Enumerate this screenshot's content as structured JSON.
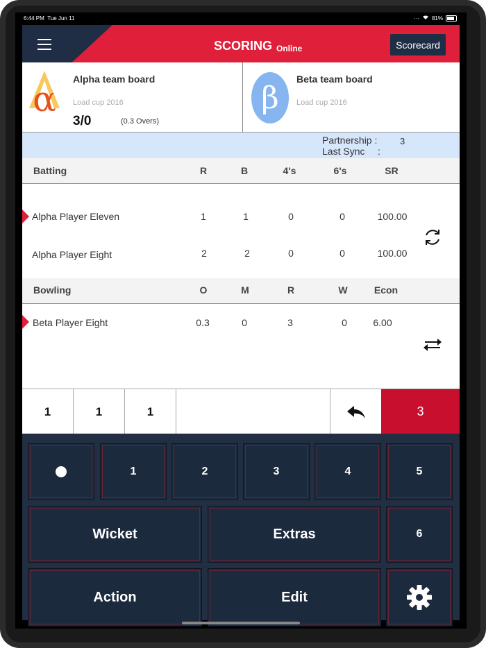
{
  "status_bar": {
    "time": "6:44 PM",
    "date": "Tue Jun 11",
    "battery": "81%"
  },
  "header": {
    "title": "SCORING",
    "status": "Online",
    "scorecard_label": "Scorecard"
  },
  "team_a": {
    "name": "Alpha team board",
    "tournament": "Load cup 2016",
    "score": "3/0",
    "overs": "(0.3 Overs)",
    "logo": "alpha-logo"
  },
  "team_b": {
    "name": "Beta team board",
    "tournament": "Load cup 2016",
    "logo": "beta-logo",
    "logo_glyph": "β"
  },
  "info": {
    "partnership_label": "Partnership :",
    "partnership_value": "3",
    "last_sync_label": "Last Sync",
    "last_sync_colon": ":"
  },
  "batting": {
    "headers": [
      "Batting",
      "R",
      "B",
      "4's",
      "6's",
      "SR"
    ],
    "rows": [
      {
        "name": "Alpha Player Eleven",
        "r": "1",
        "b": "1",
        "fours": "0",
        "sixes": "0",
        "sr": "100.00",
        "on_strike": true
      },
      {
        "name": "Alpha Player Eight",
        "r": "2",
        "b": "2",
        "fours": "0",
        "sixes": "0",
        "sr": "100.00",
        "on_strike": false
      }
    ]
  },
  "bowling": {
    "headers": [
      "Bowling",
      "O",
      "M",
      "R",
      "W",
      "Econ"
    ],
    "rows": [
      {
        "name": "Beta Player Eight",
        "o": "0.3",
        "m": "0",
        "r": "3",
        "w": "0",
        "econ": "6.00"
      }
    ]
  },
  "over_balls": [
    "1",
    "1",
    "1"
  ],
  "over_total": "3",
  "keypad": {
    "runs": [
      "1",
      "2",
      "3",
      "4",
      "5",
      "6"
    ],
    "wicket": "Wicket",
    "extras": "Extras",
    "action": "Action",
    "edit": "Edit"
  },
  "colors": {
    "accent": "#e0203a",
    "navy": "#1f2d45",
    "info_bg": "#d6e6fb",
    "total_bg": "#c8102e"
  }
}
